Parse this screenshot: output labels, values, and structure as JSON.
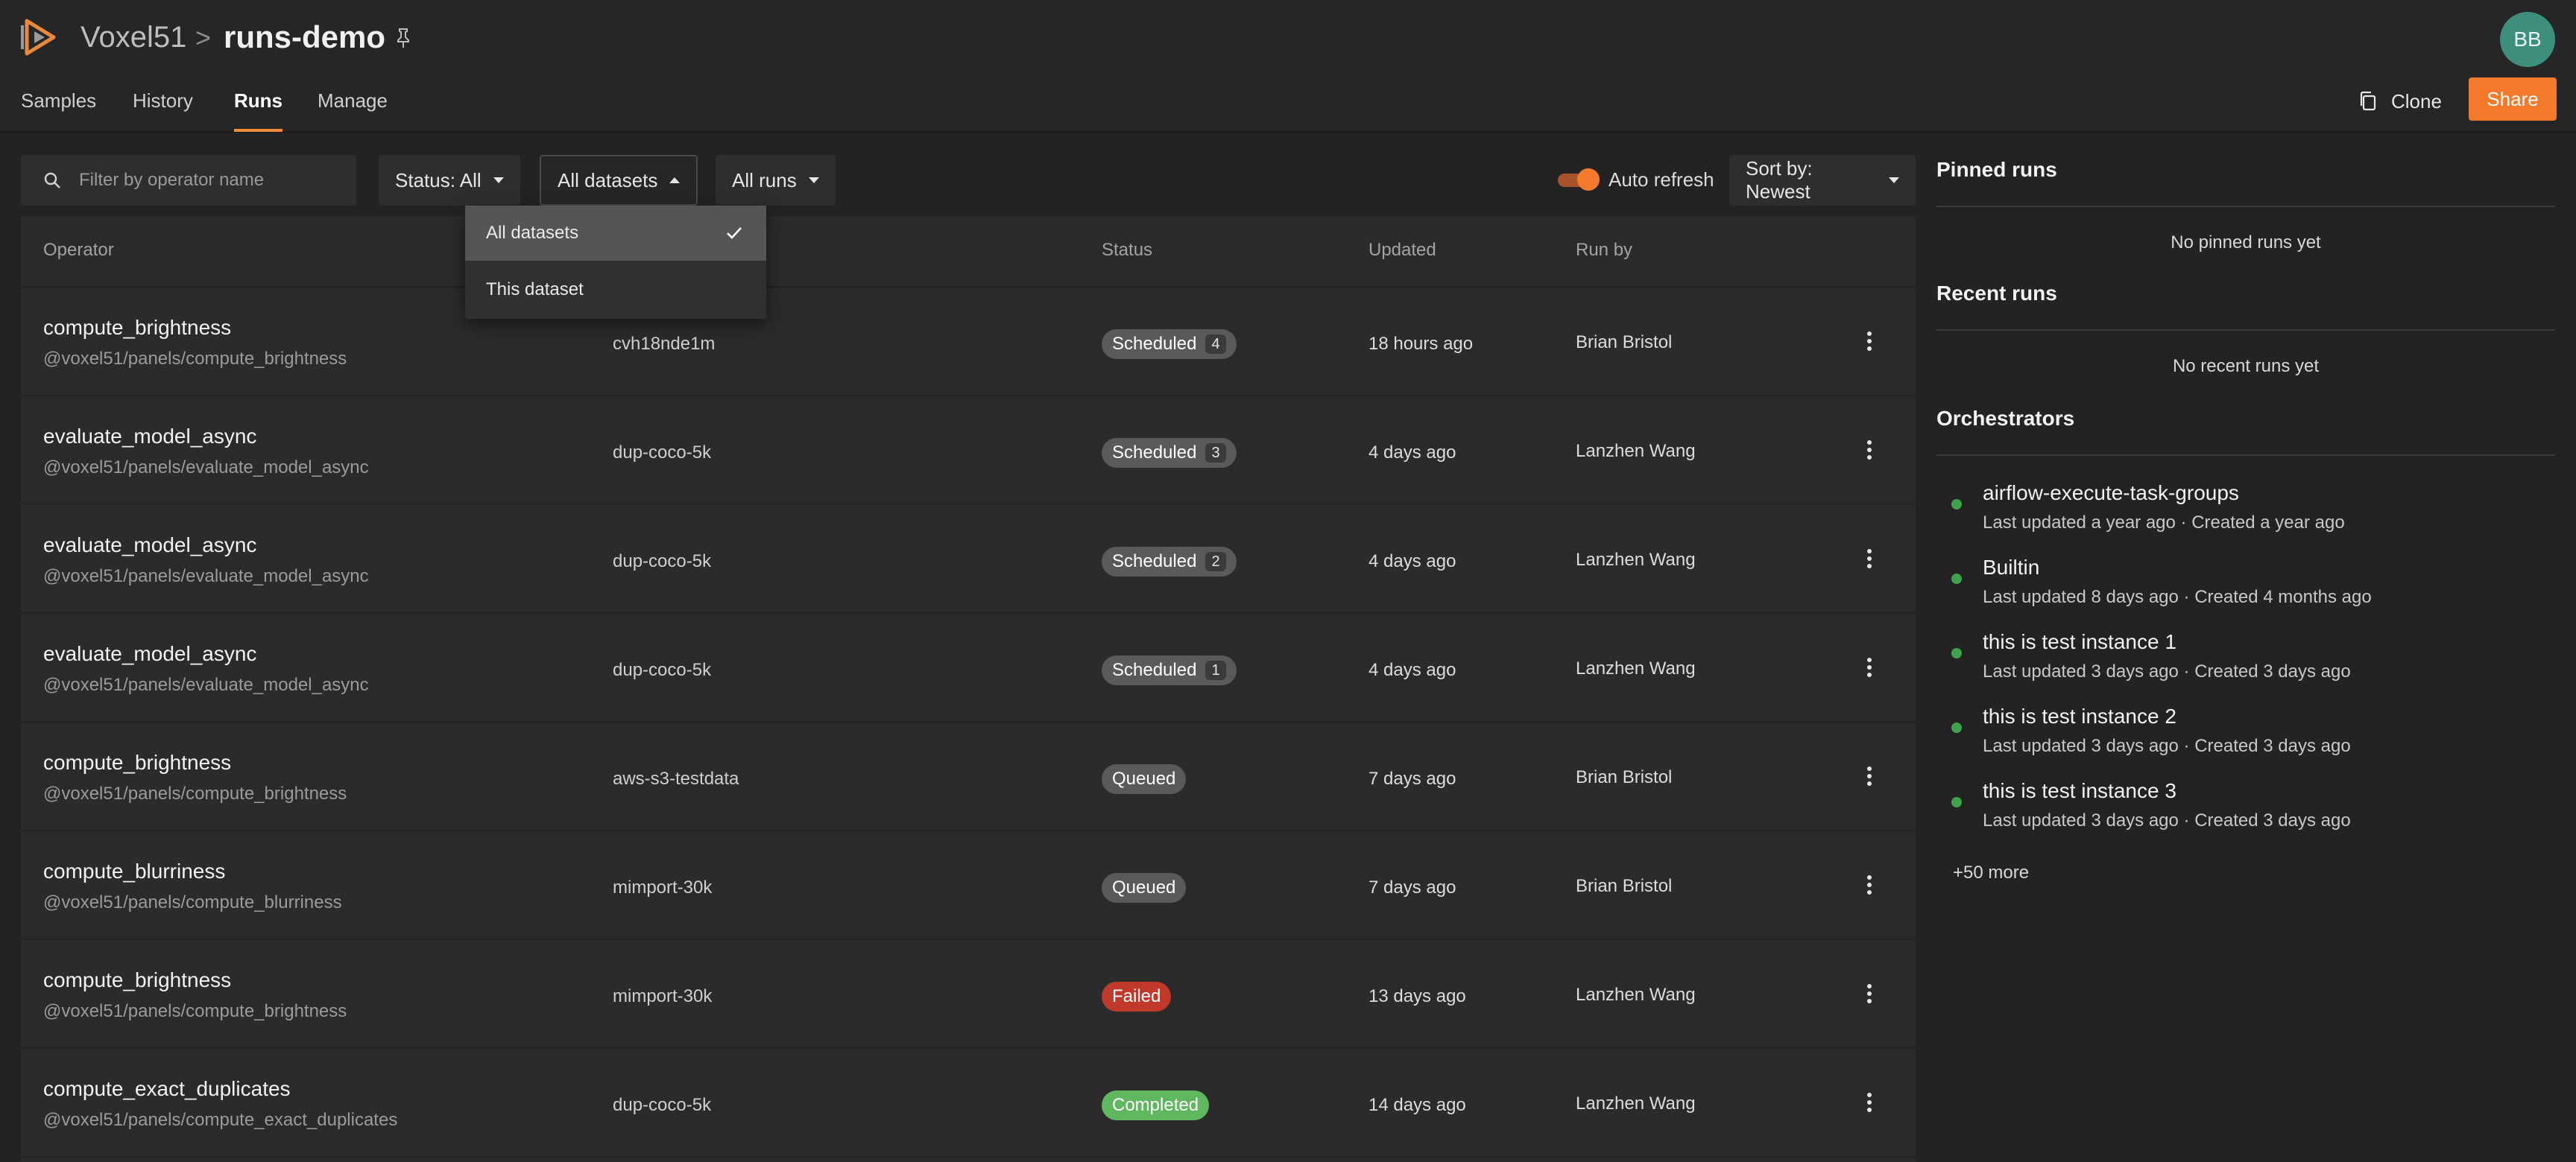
{
  "header": {
    "brand": "Voxel51",
    "separator": ">",
    "dataset_name": "runs-demo",
    "avatar_initials": "BB"
  },
  "nav": {
    "tabs": [
      {
        "label": "Samples"
      },
      {
        "label": "History"
      },
      {
        "label": "Runs",
        "active": true
      },
      {
        "label": "Manage"
      }
    ],
    "clone_label": "Clone",
    "share_label": "Share"
  },
  "filters": {
    "search_placeholder": "Filter by operator name",
    "status": "Status: All",
    "datasets": "All datasets",
    "runs": "All runs",
    "auto_refresh": "Auto refresh",
    "auto_refresh_on": true,
    "sort": "Sort by: Newest"
  },
  "dataset_menu": {
    "options": [
      "All datasets",
      "This dataset"
    ],
    "selected": "All datasets"
  },
  "table": {
    "columns": {
      "operator": "Operator",
      "status": "Status",
      "updated": "Updated",
      "run_by": "Run by"
    },
    "rows": [
      {
        "name": "compute_brightness",
        "uri": "@voxel51/panels/compute_brightness",
        "dataset": "cvh18nde1m",
        "status": "Scheduled",
        "count": "4",
        "updated": "18 hours ago",
        "run_by": "Brian Bristol"
      },
      {
        "name": "evaluate_model_async",
        "uri": "@voxel51/panels/evaluate_model_async",
        "dataset": "dup-coco-5k",
        "status": "Scheduled",
        "count": "3",
        "updated": "4 days ago",
        "run_by": "Lanzhen Wang"
      },
      {
        "name": "evaluate_model_async",
        "uri": "@voxel51/panels/evaluate_model_async",
        "dataset": "dup-coco-5k",
        "status": "Scheduled",
        "count": "2",
        "updated": "4 days ago",
        "run_by": "Lanzhen Wang"
      },
      {
        "name": "evaluate_model_async",
        "uri": "@voxel51/panels/evaluate_model_async",
        "dataset": "dup-coco-5k",
        "status": "Scheduled",
        "count": "1",
        "updated": "4 days ago",
        "run_by": "Lanzhen Wang"
      },
      {
        "name": "compute_brightness",
        "uri": "@voxel51/panels/compute_brightness",
        "dataset": "aws-s3-testdata",
        "status": "Queued",
        "count": "",
        "updated": "7 days ago",
        "run_by": "Brian Bristol"
      },
      {
        "name": "compute_blurriness",
        "uri": "@voxel51/panels/compute_blurriness",
        "dataset": "mimport-30k",
        "status": "Queued",
        "count": "",
        "updated": "7 days ago",
        "run_by": "Brian Bristol"
      },
      {
        "name": "compute_brightness",
        "uri": "@voxel51/panels/compute_brightness",
        "dataset": "mimport-30k",
        "status": "Failed",
        "count": "",
        "updated": "13 days ago",
        "run_by": "Lanzhen Wang"
      },
      {
        "name": "compute_exact_duplicates",
        "uri": "@voxel51/panels/compute_exact_duplicates",
        "dataset": "dup-coco-5k",
        "status": "Completed",
        "count": "",
        "updated": "14 days ago",
        "run_by": "Lanzhen Wang"
      }
    ]
  },
  "side": {
    "pinned_title": "Pinned runs",
    "pinned_empty": "No pinned runs yet",
    "recent_title": "Recent runs",
    "recent_empty": "No recent runs yet",
    "orchestrators_title": "Orchestrators",
    "orchestrators": [
      {
        "name": "airflow-execute-task-groups",
        "meta": "Last updated a year ago  ·  Created a year ago"
      },
      {
        "name": "Builtin",
        "meta": "Last updated 8 days ago  ·  Created 4 months ago"
      },
      {
        "name": "this is test instance 1",
        "meta": "Last updated 3 days ago  ·  Created 3 days ago"
      },
      {
        "name": "this is test instance 2",
        "meta": "Last updated 3 days ago  ·  Created 3 days ago"
      },
      {
        "name": "this is test instance 3",
        "meta": "Last updated 3 days ago  ·  Created 3 days ago"
      }
    ],
    "more_label": "+50 more"
  },
  "colors": {
    "accent": "#f47a2b",
    "scheduled": "#5a5a5a",
    "queued": "#5a5a5a",
    "failed": "#c0392b",
    "completed": "#5fb75f",
    "orchestrator_dot": "#3fa34d"
  }
}
